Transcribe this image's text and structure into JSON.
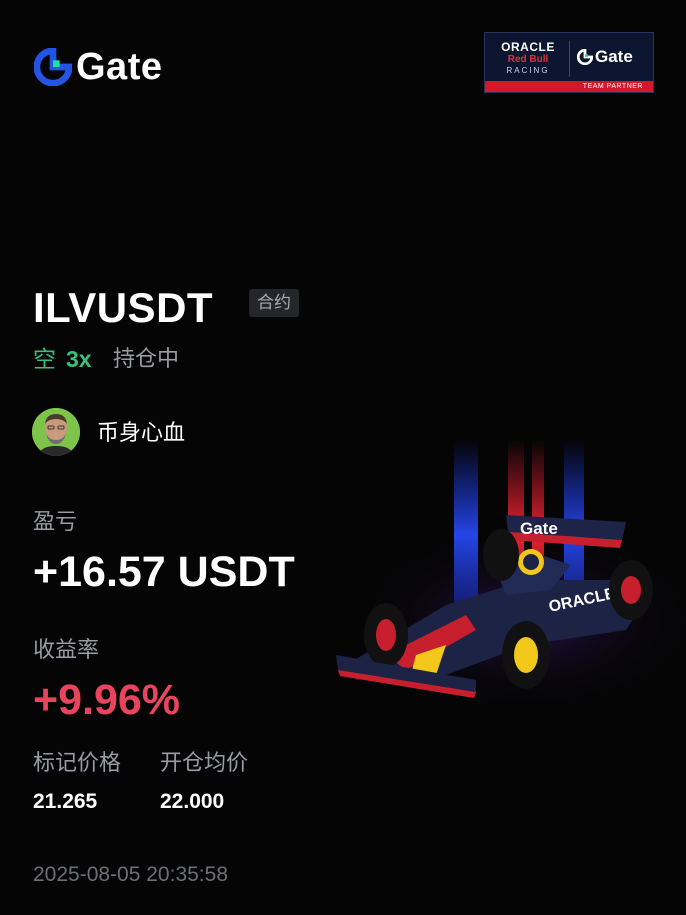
{
  "brand": {
    "name": "Gate",
    "accent": "#2354e6",
    "accent2": "#17e5a4"
  },
  "partner": {
    "line1": "ORACLE",
    "line2": "Red Bull",
    "line3": "RACING",
    "gate": "Gate",
    "strip": "TEAM PARTNER"
  },
  "position": {
    "pair": "ILVUSDT",
    "tag": "合约",
    "direction": "空",
    "leverage": "3x",
    "status": "持仓中",
    "direction_color": "#35c37a"
  },
  "user": {
    "name": "币身心血",
    "avatar_icon": "user-avatar"
  },
  "pnl": {
    "label": "盈亏",
    "value": "+16.57 USDT"
  },
  "roi": {
    "label": "收益率",
    "value": "+9.96%",
    "color": "#e8445e"
  },
  "prices": {
    "mark_label": "标记价格",
    "mark_value": "21.265",
    "open_label": "开仓均价",
    "open_value": "22.000"
  },
  "timestamp": "2025-08-05 20:35:58",
  "car_sponsor": "Gate",
  "car_sponsor2": "ORACLE"
}
